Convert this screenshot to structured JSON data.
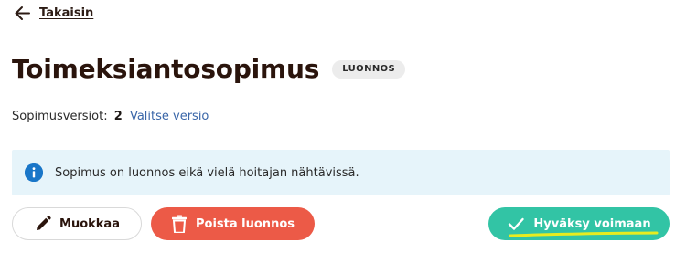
{
  "back": {
    "label": "Takaisin"
  },
  "header": {
    "title": "Toimeksiantosopimus",
    "status_badge": "LUONNOS"
  },
  "versions": {
    "label": "Sopimusversiot:",
    "count": "2",
    "select_link": "Valitse versio"
  },
  "notice": {
    "text": "Sopimus on luonnos eikä vielä hoitajan nähtävissä."
  },
  "actions": {
    "edit_label": "Muokkaa",
    "delete_label": "Poista luonnos",
    "approve_label": "Hyväksy voimaan"
  },
  "icons": {
    "back": "arrow-left-icon",
    "info": "info-icon",
    "edit": "pencil-icon",
    "delete": "trash-icon",
    "approve": "checkmark-icon"
  },
  "colors": {
    "title": "#2a140c",
    "link": "#3a66a8",
    "info_background": "#e6f4fa",
    "info_icon": "#1976c8",
    "delete_button": "#ec5a47",
    "approve_button": "#32c4a5",
    "highlight_mark": "#e8ec1f"
  }
}
